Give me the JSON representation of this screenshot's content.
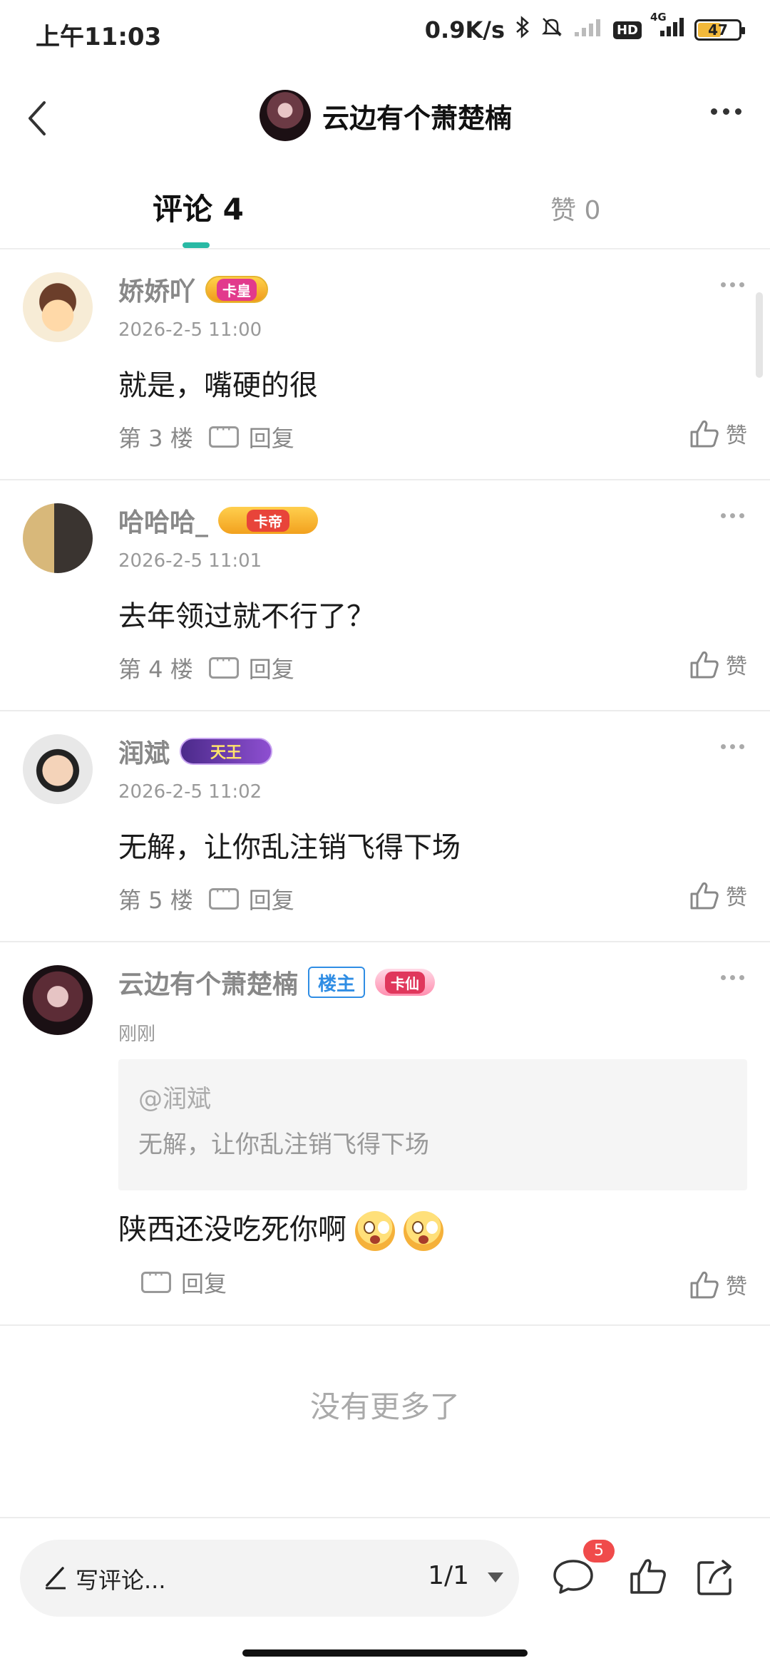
{
  "status_bar": {
    "time": "上午11:03",
    "net_speed": "0.9K/s",
    "network": "4G",
    "battery": "47",
    "hd_label": "HD"
  },
  "header": {
    "title": "云边有个萧楚楠",
    "icons": [
      "back-icon",
      "avatar",
      "more-icon"
    ]
  },
  "tabs": {
    "comments": "评论 4",
    "likes": "赞 0"
  },
  "comments": [
    {
      "username": "娇娇吖",
      "badge": "卡皇",
      "time": "2026-2-5 11:00",
      "content": "就是，嘴硬的很",
      "floor": "第 3 楼",
      "reply_label": "回复",
      "like_label": "赞"
    },
    {
      "username": "哈哈哈_",
      "badge": "卡帝",
      "time": "2026-2-5 11:01",
      "content": "去年领过就不行了？",
      "floor": "第 4 楼",
      "reply_label": "回复",
      "like_label": "赞"
    },
    {
      "username": "润斌",
      "badge": "天王",
      "time": "2026-2-5 11:02",
      "content": "无解，让你乱注销飞得下场",
      "floor": "第 5 楼",
      "reply_label": "回复",
      "like_label": "赞"
    },
    {
      "username": "云边有个萧楚楠",
      "op_badge": "楼主",
      "badge": "卡仙",
      "time": "刚刚",
      "quote_user": "@润斌",
      "quote_text": "无解，让你乱注销飞得下场",
      "content": "陕西还没吃死你啊",
      "reply_label": "回复",
      "like_label": "赞"
    }
  ],
  "footer_message": "没有更多了",
  "bottom_bar": {
    "write_placeholder": "写评论...",
    "page": "1/1",
    "comment_count_badge": "5"
  },
  "colors": {
    "accent": "#28b9a4",
    "badge_red": "#f04b4b",
    "op_blue": "#2f8de4"
  }
}
